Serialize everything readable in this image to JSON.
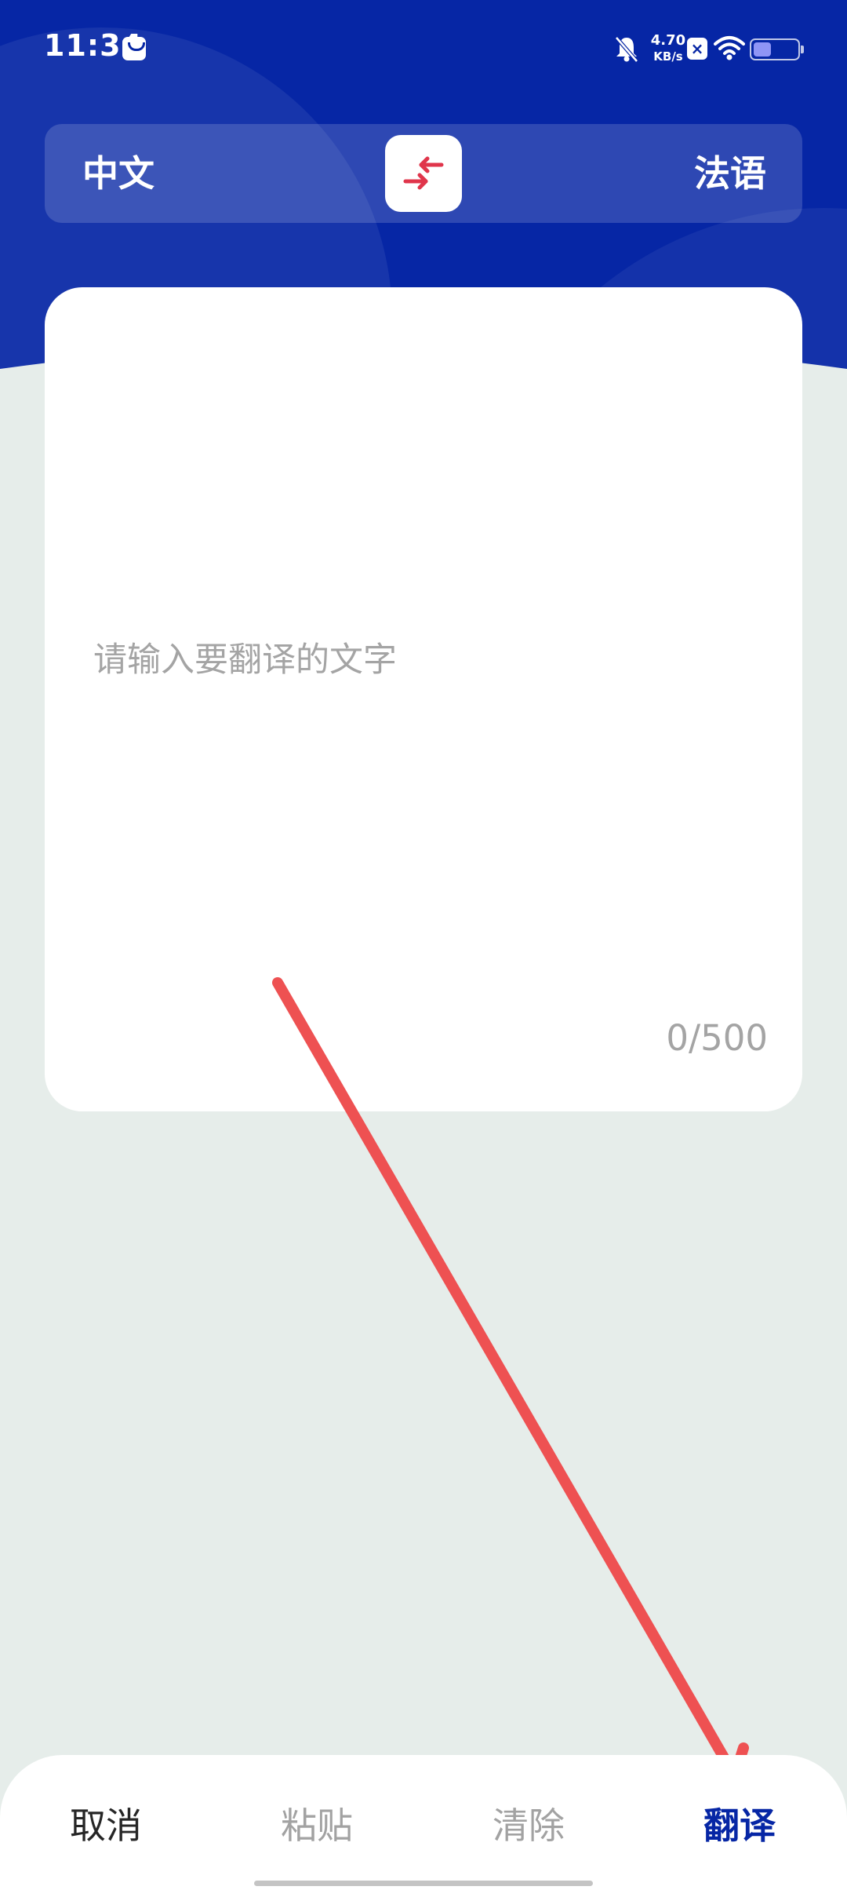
{
  "status_bar": {
    "time": "11:34",
    "net_speed_value": "4.70",
    "net_speed_unit": "KB/s",
    "battery_level": 0.4,
    "icons": [
      "message-icon",
      "bell-muted-icon",
      "close-box-icon",
      "wifi-icon",
      "battery-icon"
    ]
  },
  "language_bar": {
    "source": "中文",
    "target": "法语",
    "swap_icon": "swap-arrows-icon"
  },
  "input": {
    "placeholder": "请输入要翻译的文字",
    "value": "",
    "char_count": "0/500"
  },
  "bottom_bar": {
    "cancel": "取消",
    "paste": "粘贴",
    "clear": "清除",
    "translate": "翻译"
  },
  "colors": {
    "primary": "#0626A5",
    "background": "#E6EDEA",
    "swap_arrows": "#E0354B",
    "annotation_arrow": "#EE5152",
    "disabled_text": "#A2A2A2"
  }
}
